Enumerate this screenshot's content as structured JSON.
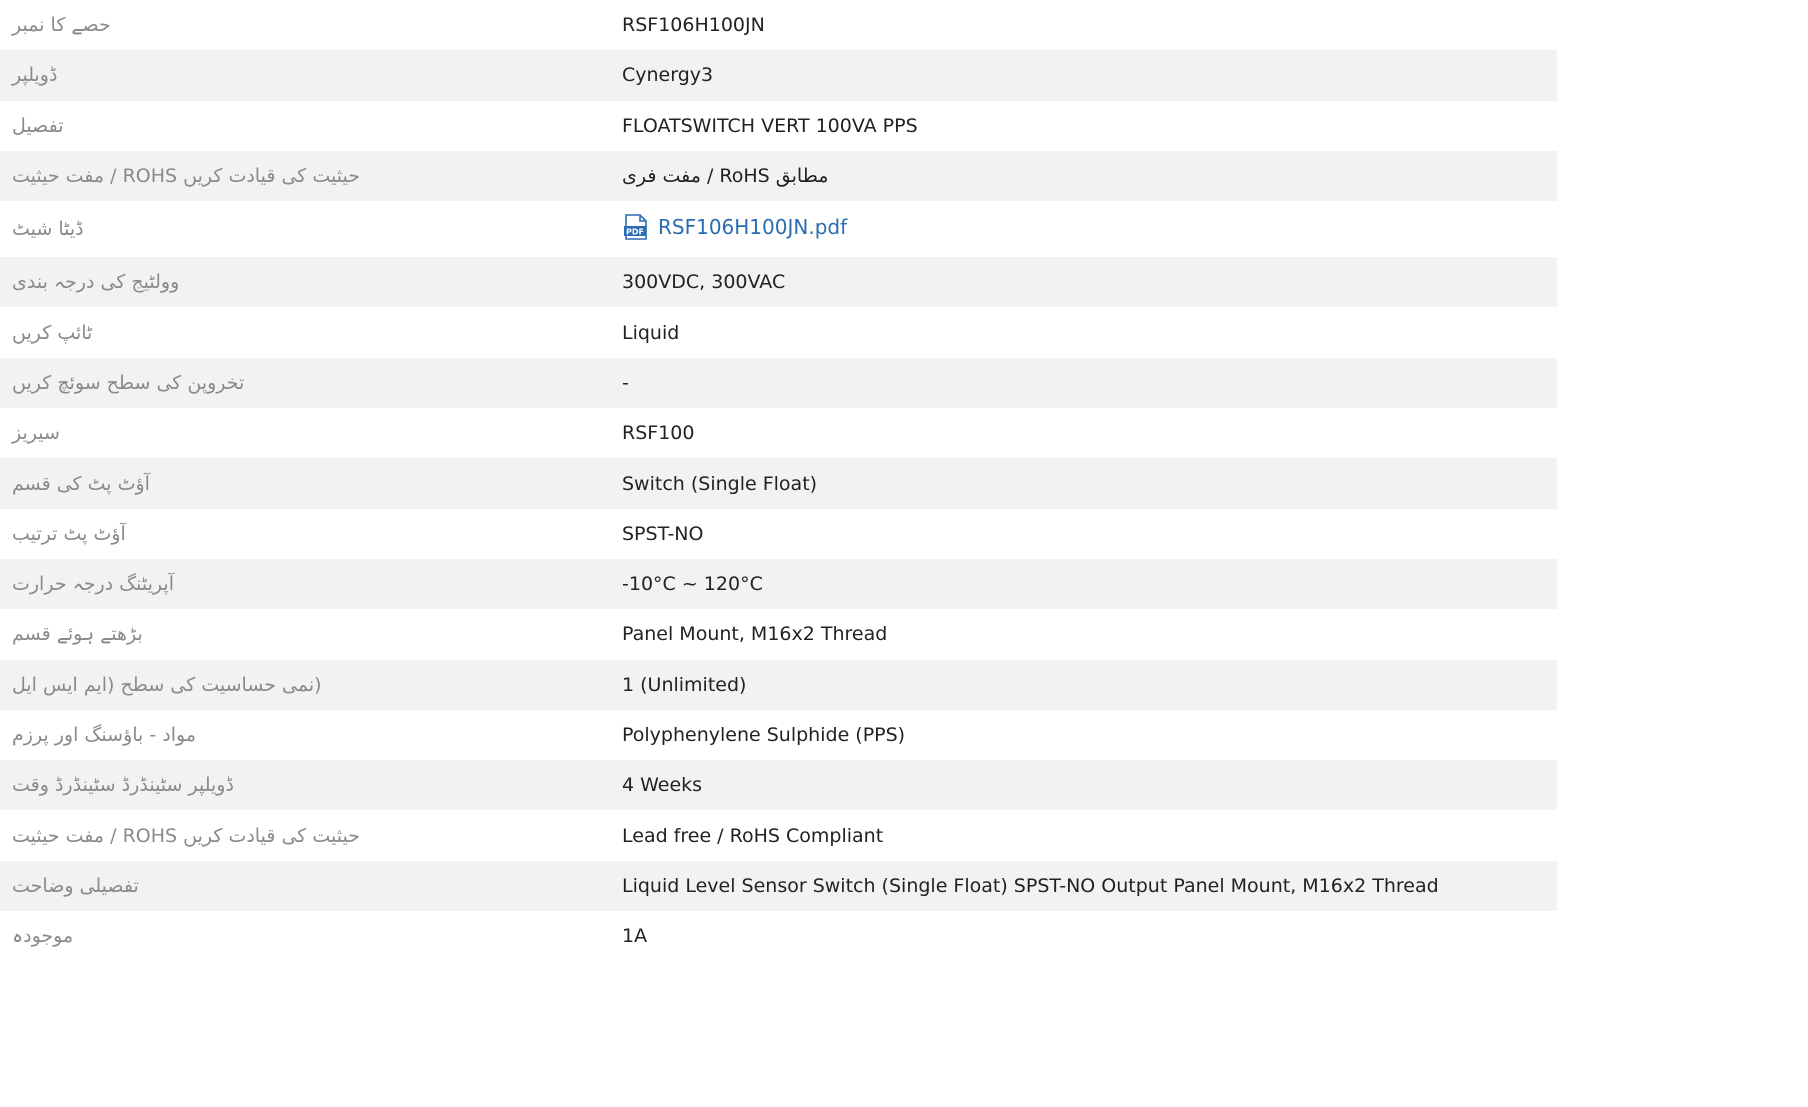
{
  "colors": {
    "label": "#8a8a8a",
    "value": "#222222",
    "link": "#2a6db0",
    "stripe": "#f2f2f2"
  },
  "rows": [
    {
      "label": "حصے کا نمبر",
      "value": "RSF106H100JN"
    },
    {
      "label": "ڈویلپر",
      "value": "Cynergy3"
    },
    {
      "label": "تفصیل",
      "value": "FLOATSWITCH VERT 100VA PPS"
    },
    {
      "label": "حیثیت کی قیادت کریں ROHS / مفت حیثیت",
      "value": "مطابق RoHS / مفت فری"
    },
    {
      "label": "ڈیٹا شیٹ",
      "value": "RSF106H100JN.pdf",
      "icon": "pdf-file-icon"
    },
    {
      "label": "وولٹیج کی درجہ بندی",
      "value": "300VDC, 300VAC"
    },
    {
      "label": "ٹائپ کریں",
      "value": "Liquid"
    },
    {
      "label": "تخروپن کی سطح سوئچ کریں",
      "value": "-"
    },
    {
      "label": "سیریز",
      "value": "RSF100"
    },
    {
      "label": "آؤٹ پٹ کی قسم",
      "value": "Switch (Single Float)"
    },
    {
      "label": "آؤٹ پٹ ترتیب",
      "value": "SPST-NO"
    },
    {
      "label": "آپریٹنگ درجہ حرارت",
      "value": "-10°C ~ 120°C"
    },
    {
      "label": "بڑھتے ہوئے قسم",
      "value": "Panel Mount, M16x2 Thread"
    },
    {
      "label": "(نمی حساسیت کی سطح (ایم ایس ایل",
      "value": "1 (Unlimited)"
    },
    {
      "label": "مواد - باؤسنگ اور پرزم",
      "value": "Polyphenylene Sulphide (PPS)"
    },
    {
      "label": "ڈویلپر سٹینڈرڈ سٹینڈرڈ وقت",
      "value": "4 Weeks"
    },
    {
      "label": "حیثیت کی قیادت کریں ROHS / مفت حیثیت",
      "value": "Lead free / RoHS Compliant"
    },
    {
      "label": "تفصیلی وضاحت",
      "value": "Liquid Level Sensor Switch (Single Float) SPST-NO Output Panel Mount, M16x2 Thread"
    },
    {
      "label": "موجودہ",
      "value": "1A"
    }
  ]
}
